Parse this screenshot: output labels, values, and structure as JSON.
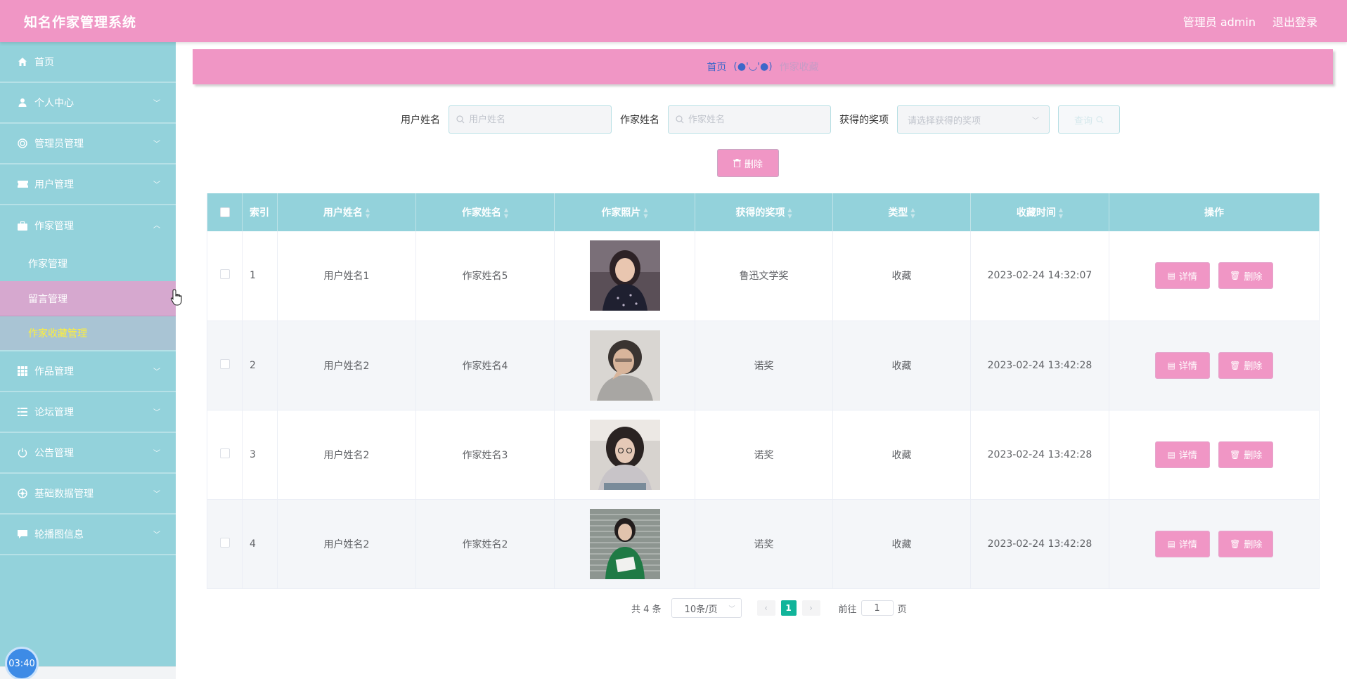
{
  "header": {
    "title": "知名作家管理系统",
    "user_label": "管理员 admin",
    "logout_label": "退出登录"
  },
  "sidebar": {
    "items": [
      {
        "label": "首页",
        "icon": "home-icon"
      },
      {
        "label": "个人中心",
        "icon": "user-icon"
      },
      {
        "label": "管理员管理",
        "icon": "settings-icon"
      },
      {
        "label": "用户管理",
        "icon": "ticket-icon"
      },
      {
        "label": "作家管理",
        "icon": "briefcase-icon",
        "expanded": true
      },
      {
        "label": "作品管理",
        "icon": "grid-icon"
      },
      {
        "label": "论坛管理",
        "icon": "list-icon"
      },
      {
        "label": "公告管理",
        "icon": "power-icon"
      },
      {
        "label": "基础数据管理",
        "icon": "aperture-icon"
      },
      {
        "label": "轮播图信息",
        "icon": "chat-icon"
      }
    ],
    "submenu": [
      {
        "label": "作家管理"
      },
      {
        "label": "留言管理"
      },
      {
        "label": "作家收藏管理"
      }
    ]
  },
  "clock": "03:40",
  "breadcrumb": {
    "home": "首页",
    "separator": "(●'◡'●)",
    "current": "作家收藏"
  },
  "search": {
    "user_label": "用户姓名",
    "user_placeholder": "用户姓名",
    "writer_label": "作家姓名",
    "writer_placeholder": "作家姓名",
    "award_label": "获得的奖项",
    "award_placeholder": "请选择获得的奖项",
    "query_label": "查询"
  },
  "toolbar": {
    "delete_label": "删除"
  },
  "table": {
    "columns": [
      "索引",
      "用户姓名",
      "作家姓名",
      "作家照片",
      "获得的奖项",
      "类型",
      "收藏时间",
      "操作"
    ],
    "rows": [
      {
        "index": "1",
        "user": "用户姓名1",
        "writer": "作家姓名5",
        "award": "鲁迅文学奖",
        "type": "收藏",
        "time": "2023-02-24 14:32:07"
      },
      {
        "index": "2",
        "user": "用户姓名2",
        "writer": "作家姓名4",
        "award": "诺奖",
        "type": "收藏",
        "time": "2023-02-24 13:42:28"
      },
      {
        "index": "3",
        "user": "用户姓名2",
        "writer": "作家姓名3",
        "award": "诺奖",
        "type": "收藏",
        "time": "2023-02-24 13:42:28"
      },
      {
        "index": "4",
        "user": "用户姓名2",
        "writer": "作家姓名2",
        "award": "诺奖",
        "type": "收藏",
        "time": "2023-02-24 13:42:28"
      }
    ],
    "detail_label": "详情",
    "delete_label": "删除"
  },
  "pagination": {
    "total": "共 4 条",
    "page_size": "10条/页",
    "current_page": "1",
    "goto_prefix": "前往",
    "goto_value": "1",
    "goto_suffix": "页"
  },
  "colors": {
    "header": "#f096c5",
    "sidebar": "#93d2db",
    "active_text": "#ffef3a",
    "pager_active": "#11b49a"
  }
}
